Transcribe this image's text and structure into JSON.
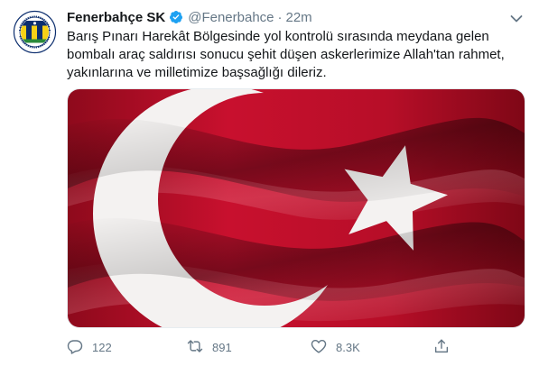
{
  "tweet": {
    "display_name": "Fenerbahçe SK",
    "handle": "@Fenerbahce",
    "separator": "·",
    "timestamp": "22m",
    "text_lines": [
      "Barış Pınarı Harekât Bölgesinde yol kontrolü sırasında meydana gelen",
      "bombalı araç saldırısı sonucu şehit düşen askerlerimize Allah'tan rahmet,",
      "yakınlarına ve milletimize başsağlığı dileriz."
    ],
    "media": {
      "description_icon": "turkish-flag"
    },
    "actions": {
      "reply_count": "122",
      "retweet_count": "891",
      "like_count": "8.3K"
    }
  },
  "avatar": {
    "logo_text_top": "FENERBAHÇE SPOR KULÜBÜ",
    "logo_year": "1907"
  },
  "colors": {
    "accent": "#1da1f2",
    "secondary_text": "#657786",
    "flag_red": "#c8102e",
    "club_navy": "#0c2e6e",
    "club_yellow": "#f7d117"
  }
}
